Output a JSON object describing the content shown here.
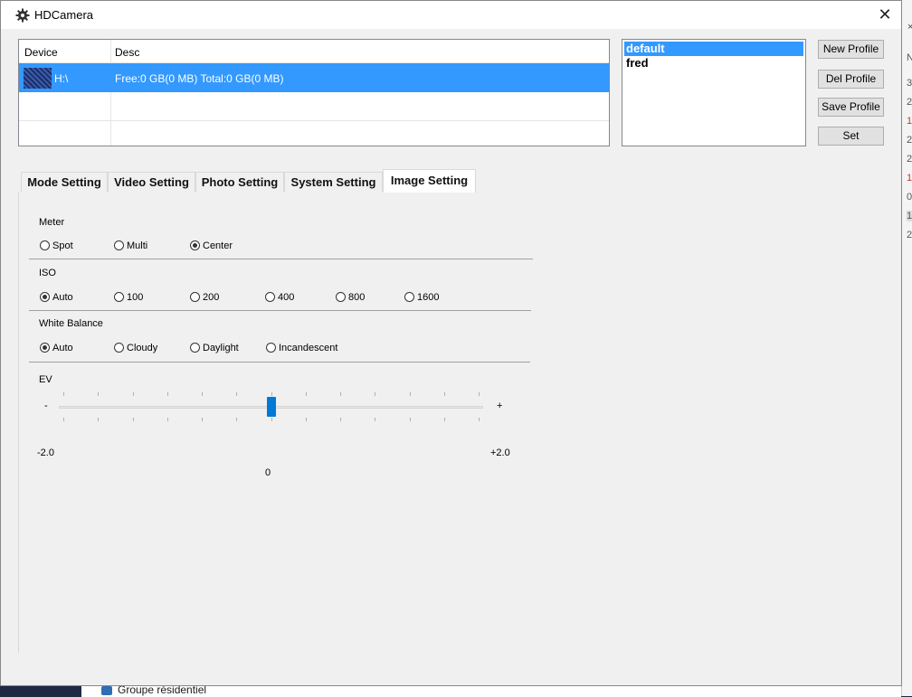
{
  "window": {
    "title": "HDCamera",
    "icon": "gear-icon",
    "close_glyph": "✕"
  },
  "device_table": {
    "headers": [
      "Device",
      "Desc"
    ],
    "rows": [
      {
        "device": "H:\\",
        "desc": "Free:0 GB(0 MB) Total:0 GB(0 MB)",
        "selected": true
      }
    ]
  },
  "profiles": {
    "items": [
      "default",
      "fred"
    ],
    "selected": "default",
    "buttons": {
      "new": "New Profile",
      "del": "Del Profile",
      "save": "Save Profile",
      "set": "Set"
    }
  },
  "tabs": [
    "Mode Setting",
    "Video Setting",
    "Photo Setting",
    "System Setting",
    "Image Setting"
  ],
  "active_tab": "Image Setting",
  "image_setting": {
    "meter": {
      "label": "Meter",
      "options": [
        "Spot",
        "Multi",
        "Center"
      ],
      "selected": "Center"
    },
    "iso": {
      "label": "ISO",
      "options": [
        "Auto",
        "100",
        "200",
        "400",
        "800",
        "1600"
      ],
      "selected": "Auto"
    },
    "white_balance": {
      "label": "White Balance",
      "options": [
        "Auto",
        "Cloudy",
        "Daylight",
        "Incandescent"
      ],
      "selected": "Auto"
    },
    "ev": {
      "label": "EV",
      "minus": "-",
      "plus": "+",
      "min_label": "-2.0",
      "max_label": "+2.0",
      "value_label": "0",
      "value": 0,
      "min": -2.0,
      "max": 2.0
    }
  },
  "background": {
    "taskbar_item": "Groupe résidentiel",
    "side_close": "×",
    "side_digits": [
      "N",
      "3",
      "2",
      "1",
      "2",
      "2",
      "1",
      "0",
      "1",
      "2"
    ]
  },
  "colors": {
    "selection": "#3399ff",
    "slider_thumb": "#0078d7"
  }
}
